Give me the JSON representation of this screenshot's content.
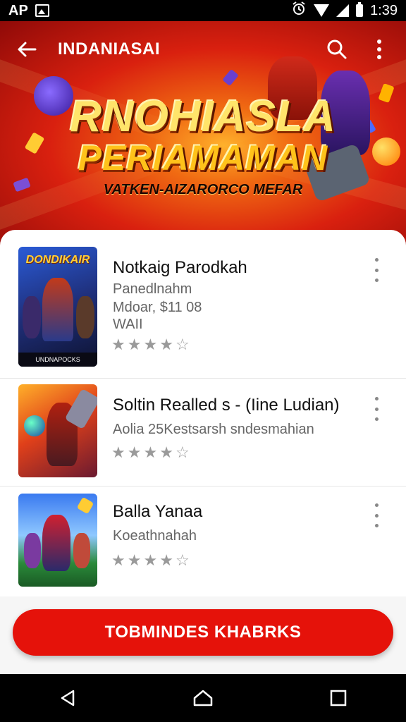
{
  "status_bar": {
    "left_text": "AP",
    "time": "1:39"
  },
  "app_bar": {
    "title": "INDANIASAI"
  },
  "hero": {
    "line1": "RNOHIASLA",
    "line2": "PERIAMAMAN",
    "subtitle": "VATKEN-AIZARORCO MEFAR"
  },
  "apps": [
    {
      "title": "Notkaig Parodkah",
      "subtitle_lines": [
        "Panedlnahm",
        "Mdoar, $11 08",
        "WAII"
      ],
      "thumb_text": "DONDIKAIR",
      "thumb_footer": "UNDNAPOCKS"
    },
    {
      "title": "Soltin Realled s - (Iine Ludian)",
      "subtitle_lines": [
        "Aolia 25Kestsarsh sndesmahian"
      ]
    },
    {
      "title": "Balla Yanaa",
      "subtitle_lines": [
        "Koeathnahah"
      ]
    }
  ],
  "cta": {
    "label": "TOBMINDES KHABRKS"
  },
  "colors": {
    "accent": "#e5120a",
    "hero_dark": "#8f0a08",
    "hero_light": "#ffb02a"
  },
  "icons": {
    "back": "arrow-left-icon",
    "search": "search-icon",
    "more": "more-vert-icon",
    "nav_back": "nav-back-icon",
    "nav_home": "nav-home-icon",
    "nav_recents": "nav-recents-icon"
  }
}
